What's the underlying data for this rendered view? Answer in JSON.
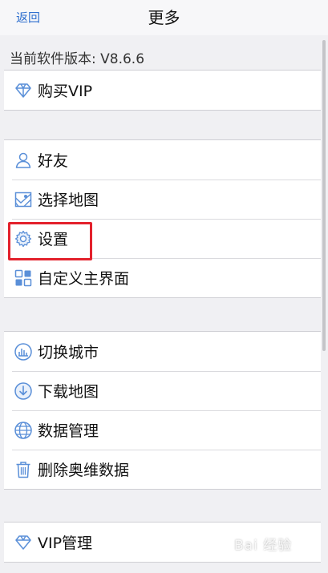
{
  "nav": {
    "back_label": "返回",
    "title": "更多"
  },
  "version_text": "当前软件版本: V8.6.6",
  "groups": [
    {
      "items": [
        {
          "label": "购买VIP",
          "icon": "diamond-icon"
        }
      ]
    },
    {
      "items": [
        {
          "label": "好友",
          "icon": "user-icon"
        },
        {
          "label": "选择地图",
          "icon": "map-icon"
        },
        {
          "label": "设置",
          "icon": "gear-icon"
        },
        {
          "label": "自定义主界面",
          "icon": "grid-icon"
        }
      ]
    },
    {
      "items": [
        {
          "label": "切换城市",
          "icon": "city-icon"
        },
        {
          "label": "下载地图",
          "icon": "download-icon"
        },
        {
          "label": "数据管理",
          "icon": "globe-icon"
        },
        {
          "label": "删除奥维数据",
          "icon": "trash-icon"
        }
      ]
    },
    {
      "items": [
        {
          "label": "VIP管理",
          "icon": "vip-diamond-icon"
        }
      ]
    }
  ],
  "watermark": "Bai 经验",
  "colors": {
    "accent": "#2f6fce",
    "icon": "#5a8fd8",
    "highlight": "#e3212c"
  }
}
